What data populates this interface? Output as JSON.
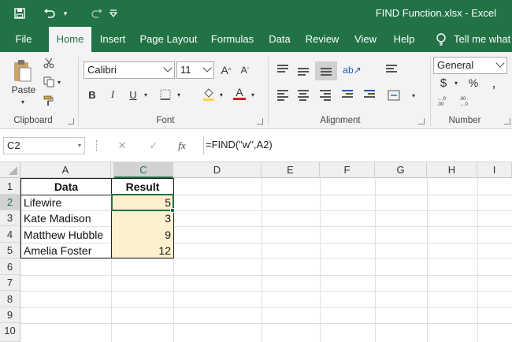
{
  "window": {
    "title": "FIND Function.xlsx  -  Excel"
  },
  "quick_access": {
    "save_icon": "save-icon",
    "undo_icon": "undo-icon",
    "redo_icon": "redo-icon",
    "customize_icon": "customize-icon"
  },
  "tabs": [
    {
      "label": "File"
    },
    {
      "label": "Home"
    },
    {
      "label": "Insert"
    },
    {
      "label": "Page Layout"
    },
    {
      "label": "Formulas"
    },
    {
      "label": "Data"
    },
    {
      "label": "Review"
    },
    {
      "label": "View"
    },
    {
      "label": "Help"
    },
    {
      "label": "Tell me what"
    }
  ],
  "ribbon": {
    "clipboard": {
      "paste_label": "Paste",
      "group_label": "Clipboard"
    },
    "font": {
      "font_name": "Calibri",
      "font_size": "11",
      "group_label": "Font",
      "bold": "B",
      "italic": "I",
      "underline": "U",
      "grow": "A",
      "shrink": "A",
      "font_color_glyph": "A"
    },
    "alignment": {
      "group_label": "Alignment"
    },
    "number": {
      "format": "General",
      "currency": "$",
      "percent": "%",
      "comma": ",",
      "group_label": "Number"
    }
  },
  "formula_bar": {
    "name_box": "C2",
    "cancel": "✕",
    "enter": "✓",
    "fx": "fx",
    "formula": "=FIND(\"w\",A2)"
  },
  "columns": [
    "A",
    "C",
    "D",
    "E",
    "F",
    "G",
    "H",
    "I"
  ],
  "rows": [
    "1",
    "2",
    "3",
    "4",
    "5",
    "6",
    "7",
    "8",
    "9",
    "10"
  ],
  "sheet": {
    "header_data": "Data",
    "header_result": "Result",
    "rows": [
      {
        "data": "Lifewire",
        "result": "5"
      },
      {
        "data": "Kate Madison",
        "result": "3"
      },
      {
        "data": "Matthew Hubble",
        "result": "9"
      },
      {
        "data": "Amelia Foster",
        "result": "12"
      }
    ]
  },
  "colors": {
    "excel_green": "#217346",
    "highlight": "#fdf0cf",
    "ribbon_bg": "#f3f3f3"
  }
}
